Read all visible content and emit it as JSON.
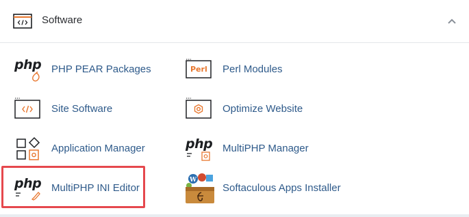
{
  "section": {
    "title": "Software",
    "header_icon": "code-window-icon",
    "collapse_icon": "chevron-up-icon"
  },
  "items": [
    {
      "label": "PHP PEAR Packages",
      "icon": "php-pear-icon"
    },
    {
      "label": "Perl Modules",
      "icon": "perl-icon",
      "icon_text": "Perl"
    },
    {
      "label": "Site Software",
      "icon": "site-software-icon"
    },
    {
      "label": "Optimize Website",
      "icon": "optimize-website-icon"
    },
    {
      "label": "Application Manager",
      "icon": "application-manager-icon"
    },
    {
      "label": "MultiPHP Manager",
      "icon": "multiphp-manager-icon"
    },
    {
      "label": "MultiPHP INI Editor",
      "icon": "multiphp-ini-editor-icon"
    },
    {
      "label": "Softaculous Apps Installer",
      "icon": "softaculous-icon"
    }
  ],
  "php_logo_text": "php",
  "colors": {
    "link": "#2e5a8a",
    "accent_orange": "#e8772e",
    "highlight_red": "#e5484d",
    "icon_dark": "#1d1f22"
  }
}
